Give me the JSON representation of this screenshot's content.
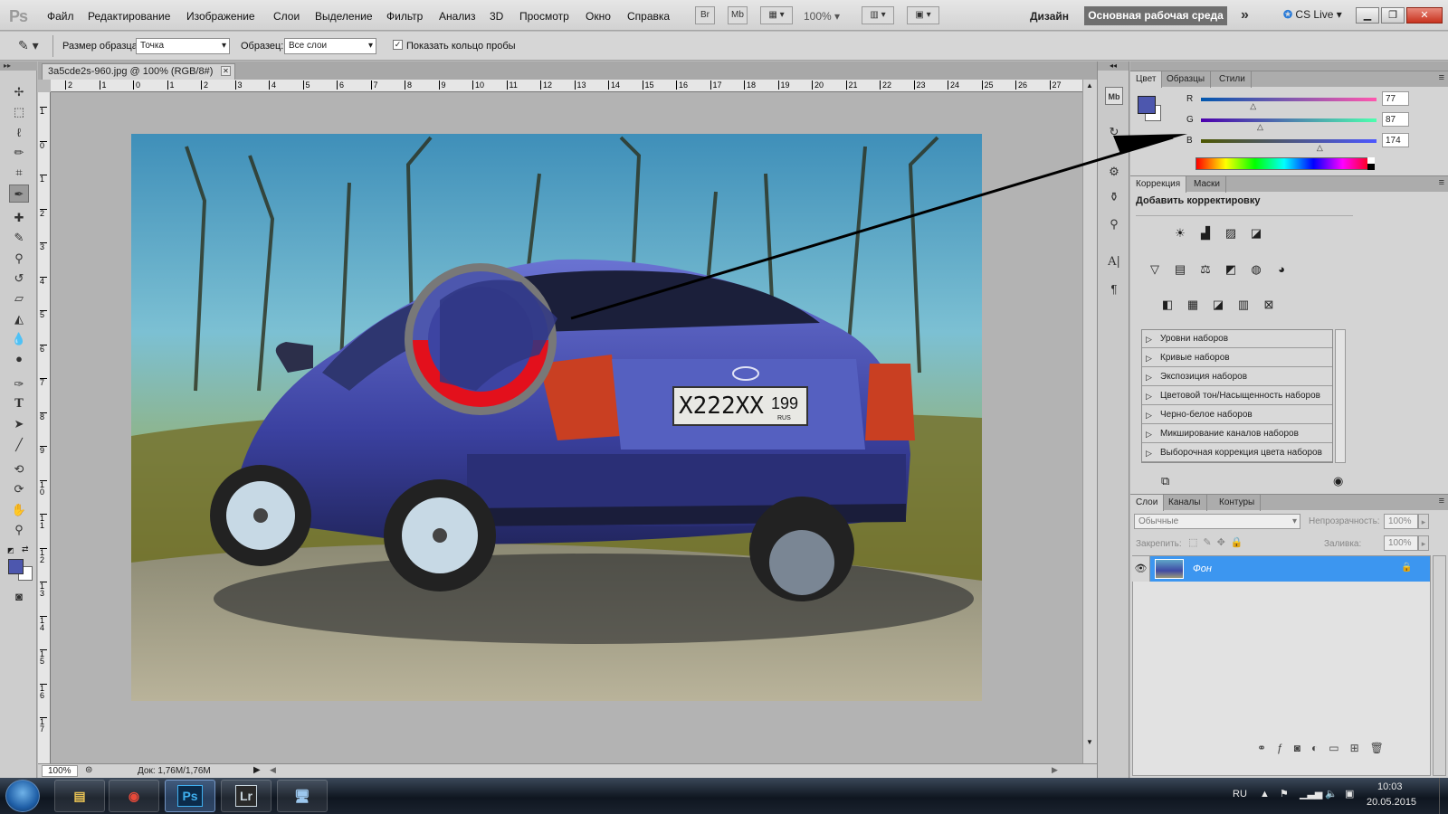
{
  "menubar": {
    "logo": "Ps",
    "items": [
      "Файл",
      "Редактирование",
      "Изображение",
      "Слои",
      "Выделение",
      "Фильтр",
      "Анализ",
      "3D",
      "Просмотр",
      "Окно",
      "Справка"
    ],
    "bridge_button": "Br",
    "minibridge_button": "Mb",
    "zoom": "100%",
    "workspace_label": "Дизайн",
    "workspace_button": "Основная рабочая среда",
    "more": "»",
    "cs_live": "CS Live"
  },
  "options": {
    "sample_size_label": "Размер образца:",
    "sample_size_value": "Точка",
    "sample_label": "Образец:",
    "sample_value": "Все слои",
    "show_ring_label": "Показать кольцо пробы"
  },
  "document": {
    "tab_title": "3a5cde2s-960.jpg @ 100% (RGB/8#)",
    "zoom": "100%",
    "doc_info": "Док: 1,76M/1,76M",
    "ruler_top": [
      "2",
      "1",
      "0",
      "1",
      "2",
      "3",
      "4",
      "5",
      "6",
      "7",
      "8",
      "9",
      "10",
      "11",
      "12",
      "13",
      "14",
      "15",
      "16",
      "17",
      "18",
      "19",
      "20",
      "21",
      "22",
      "23",
      "24",
      "25",
      "26",
      "27"
    ],
    "ruler_left": [
      "1",
      "0",
      "1",
      "2",
      "3",
      "4",
      "5",
      "6",
      "7",
      "8",
      "9",
      "1 0",
      "1 1",
      "1 2",
      "1 3",
      "1 4",
      "1 5",
      "1 6",
      "1 7"
    ],
    "plate_text": "X222XX",
    "plate_region": "199",
    "plate_country": "RUS",
    "sampler_colors": {
      "top": "#4d57ae",
      "bottom": "#e3101c",
      "ring": "#787878"
    }
  },
  "color_panel": {
    "tabs": [
      "Цвет",
      "Образцы",
      "Стили"
    ],
    "foreground": "#4d57ae",
    "channels": [
      {
        "label": "R",
        "value": "77",
        "fraction": 0.3
      },
      {
        "label": "G",
        "value": "87",
        "fraction": 0.34
      },
      {
        "label": "B",
        "value": "174",
        "fraction": 0.68
      }
    ]
  },
  "adjustments_panel": {
    "tabs": [
      "Коррекция",
      "Маски"
    ],
    "heading": "Добавить корректировку",
    "presets": [
      "Уровни наборов",
      "Кривые наборов",
      "Экспозиция наборов",
      "Цветовой тон/Насыщенность наборов",
      "Черно-белое наборов",
      "Микширование каналов наборов",
      "Выборочная коррекция цвета наборов"
    ]
  },
  "layers_panel": {
    "tabs": [
      "Слои",
      "Каналы",
      "Контуры"
    ],
    "blend_mode": "Обычные",
    "opacity_label": "Непрозрачность:",
    "opacity_value": "100%",
    "lock_label": "Закрепить:",
    "fill_label": "Заливка:",
    "fill_value": "100%",
    "layers": [
      {
        "name": "Фон"
      }
    ]
  },
  "taskbar": {
    "apps": [
      "Ps",
      "Lr"
    ],
    "lang": "RU",
    "time": "10:03",
    "date": "20.05.2015"
  }
}
